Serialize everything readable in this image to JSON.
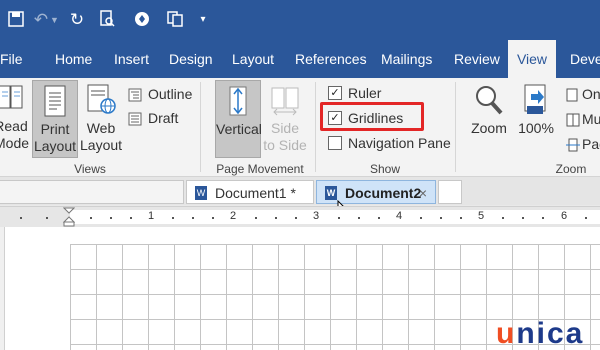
{
  "quick_access": {
    "icons": [
      "save-icon",
      "undo-icon",
      "redo-icon",
      "print-preview-icon",
      "touch-mode-icon",
      "copy-icon",
      "customize-qat-icon"
    ]
  },
  "ribbon_tabs": [
    {
      "label": "File"
    },
    {
      "label": "Home"
    },
    {
      "label": "Insert"
    },
    {
      "label": "Design"
    },
    {
      "label": "Layout"
    },
    {
      "label": "References"
    },
    {
      "label": "Mailings"
    },
    {
      "label": "Review"
    },
    {
      "label": "View",
      "active": true
    },
    {
      "label": "Deve"
    }
  ],
  "views_group": {
    "label": "Views",
    "read_mode": {
      "line1": "Read",
      "line2": "Mode"
    },
    "print_layout": {
      "line1": "Print",
      "line2": "Layout"
    },
    "web_layout": {
      "line1": "Web",
      "line2": "Layout"
    },
    "outline": "Outline",
    "draft": "Draft"
  },
  "page_movement_group": {
    "label": "Page Movement",
    "vertical": "Vertical",
    "side_to_side": {
      "line1": "Side",
      "line2": "to Side"
    }
  },
  "show_group": {
    "label": "Show",
    "ruler": {
      "label": "Ruler",
      "checked": true
    },
    "gridlines": {
      "label": "Gridlines",
      "checked": true
    },
    "navigation_pane": {
      "label": "Navigation Pane",
      "checked": false
    }
  },
  "zoom_group": {
    "label": "Zoom",
    "zoom": "Zoom",
    "percent": "100%",
    "one_page": "One",
    "multiple_pages": "Mu",
    "page_width": "Pag"
  },
  "document_tabs": [
    {
      "label": "Document1 *",
      "active": false
    },
    {
      "label": "Document2",
      "active": true,
      "close": "×"
    }
  ],
  "ruler": {
    "numbers": [
      "1",
      "2",
      "3",
      "4",
      "5",
      "6"
    ]
  },
  "watermark": {
    "text": "unica"
  },
  "colors": {
    "ribbon_blue": "#2b579a",
    "highlight_red": "#e32626",
    "watermark_orange": "#f04e23",
    "watermark_blue": "#1d3a8a"
  }
}
